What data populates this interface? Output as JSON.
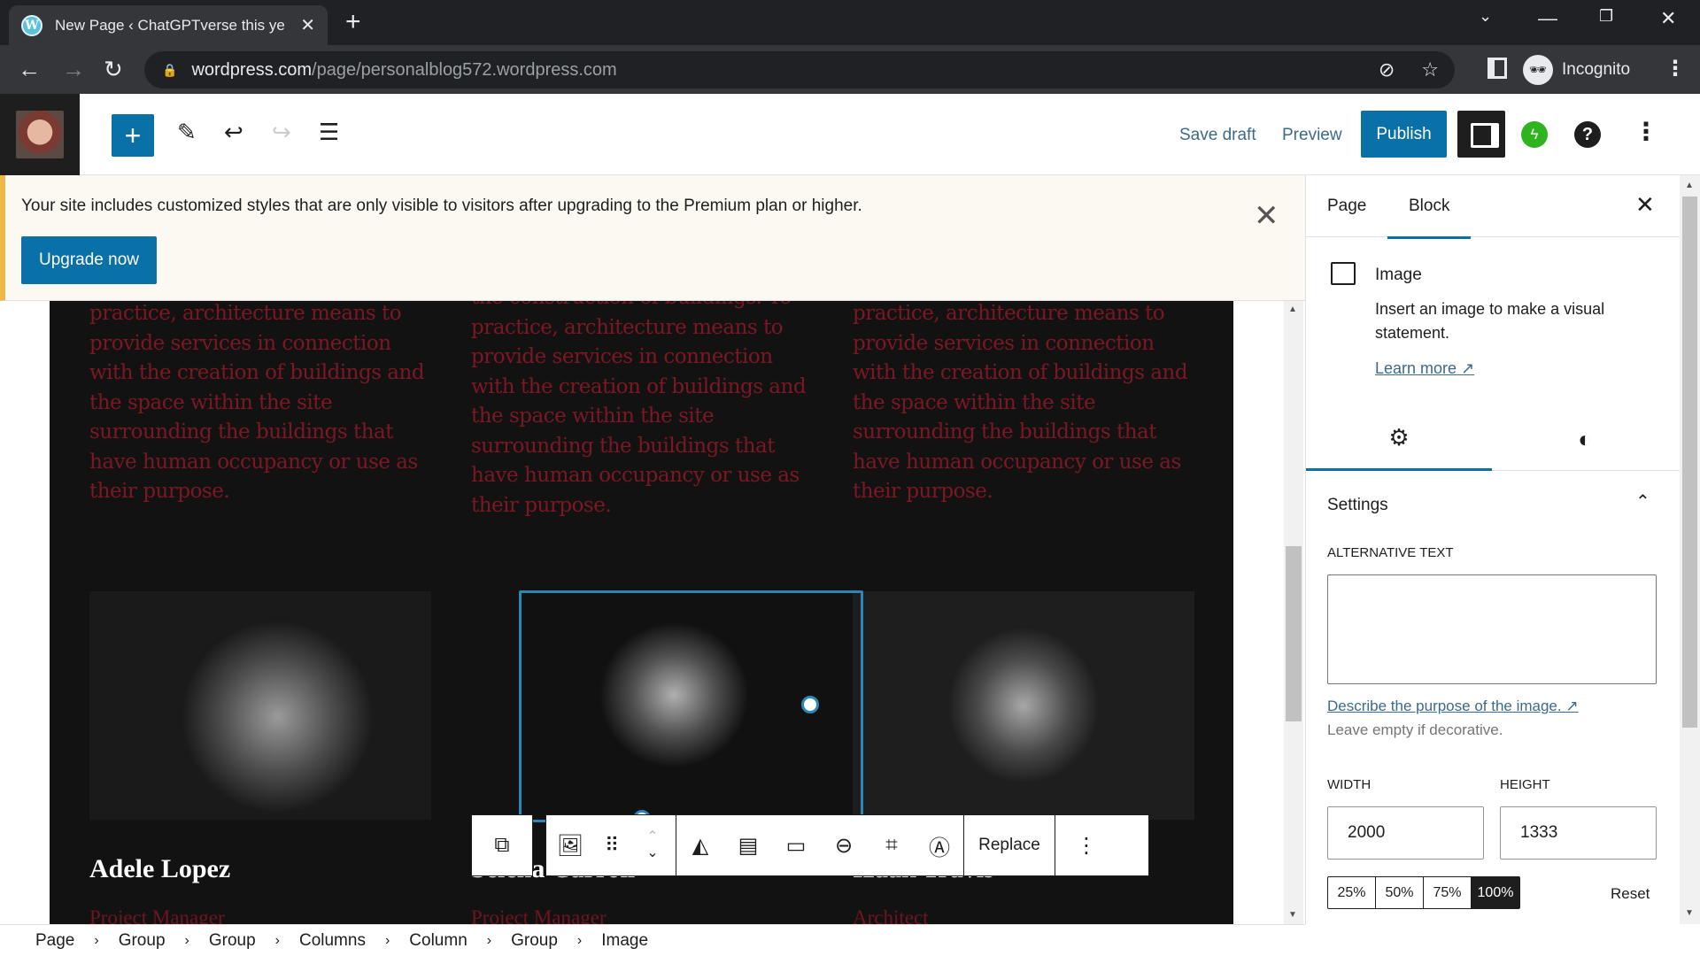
{
  "browser": {
    "tab_title": "New Page ‹ ChatGPTverse this ye",
    "url_host": "wordpress.com",
    "url_path": "/page/personalblog572.wordpress.com",
    "profile_label": "Incognito"
  },
  "toolbar": {
    "save_draft": "Save draft",
    "preview": "Preview",
    "publish": "Publish"
  },
  "notice": {
    "message": "Your site includes customized styles that are only visible to visitors after upgrading to the Premium plan or higher.",
    "button": "Upgrade now"
  },
  "content": {
    "columns": [
      {
        "top_fragment": "",
        "desc": "practice, architecture means to provide services in connection with the creation of buildings and the space within the site surrounding the buildings that have human occupancy or use as their purpose.",
        "name": "Adele Lopez",
        "role": "Project Manager"
      },
      {
        "top_fragment": "the construction of buildings. To",
        "desc": "practice, architecture means to provide services in connection with the creation of buildings and the space within the site surrounding the buildings that have human occupancy or use as their purpose.",
        "name": "Selena Carroll",
        "role": "Project Manager"
      },
      {
        "top_fragment": "",
        "desc": "practice, architecture means to provide services in connection with the creation of buildings and the space within the site surrounding the buildings that have human occupancy or use as their purpose.",
        "name": "Izaak Travis",
        "role": "Architect"
      }
    ],
    "block_toolbar": {
      "replace": "Replace"
    }
  },
  "breadcrumb": [
    "Page",
    "Group",
    "Group",
    "Columns",
    "Column",
    "Group",
    "Image"
  ],
  "sidebar": {
    "tabs": [
      {
        "label": "Page",
        "active": false
      },
      {
        "label": "Block",
        "active": true
      }
    ],
    "block": {
      "title": "Image",
      "description": "Insert an image to make a visual statement.",
      "learn_more": "Learn more"
    },
    "panel_title": "Settings",
    "alt_text": {
      "label": "Alternative text",
      "value": "",
      "help_link": "Describe the purpose of the image.",
      "help_text": "Leave empty if decorative."
    },
    "dimensions": {
      "width_label": "Width",
      "height_label": "Height",
      "width": "2000",
      "height": "1333",
      "presets": [
        "25%",
        "50%",
        "75%",
        "100%"
      ],
      "selected_preset": "100%",
      "reset": "Reset"
    }
  },
  "colors": {
    "accent": "#0a70a8",
    "selection": "#2a87b8",
    "desc_text": "#7b1823",
    "dark_bg": "#131213"
  }
}
